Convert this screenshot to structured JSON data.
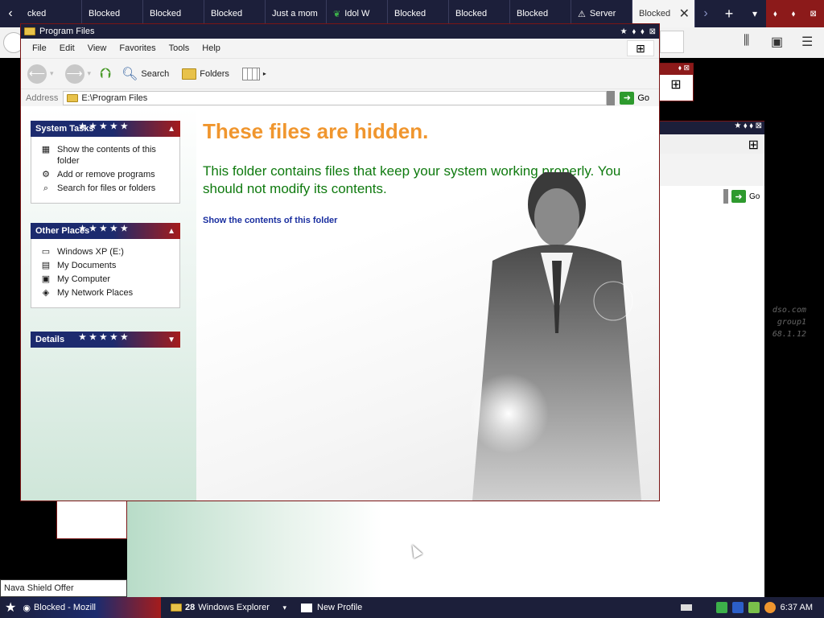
{
  "browser": {
    "tabs": [
      {
        "label": "cked"
      },
      {
        "label": "Blocked"
      },
      {
        "label": "Blocked"
      },
      {
        "label": "Blocked"
      },
      {
        "label": "Just a mom"
      },
      {
        "label": "Idol W"
      },
      {
        "label": "Blocked"
      },
      {
        "label": "Blocked"
      },
      {
        "label": "Blocked"
      },
      {
        "label": "Server"
      }
    ],
    "active_tab": "Blocked"
  },
  "background_window": {
    "go_label": "Go",
    "text_lines": [
      "dso.com",
      "group1",
      "68.1.12"
    ]
  },
  "explorer": {
    "title": "Program Files",
    "menu": [
      "File",
      "Edit",
      "View",
      "Favorites",
      "Tools",
      "Help"
    ],
    "toolbar": {
      "search": "Search",
      "folders": "Folders"
    },
    "address": {
      "label": "Address",
      "value": "E:\\Program Files",
      "go": "Go"
    },
    "system_tasks": {
      "title": "System Tasks",
      "items": [
        {
          "label": "Show the contents of this folder",
          "icon": "show-contents-icon"
        },
        {
          "label": "Add or remove programs",
          "icon": "add-remove-icon"
        },
        {
          "label": "Search for files or folders",
          "icon": "search-icon"
        }
      ]
    },
    "other_places": {
      "title": "Other Places",
      "items": [
        {
          "label": "Windows XP (E:)",
          "icon": "drive-icon"
        },
        {
          "label": "My Documents",
          "icon": "my-documents-icon"
        },
        {
          "label": "My Computer",
          "icon": "my-computer-icon"
        },
        {
          "label": "My Network Places",
          "icon": "network-places-icon"
        }
      ]
    },
    "details": {
      "title": "Details"
    },
    "content": {
      "heading": "These files are hidden.",
      "message": "This folder contains files that keep your system working properly. You should not modify its contents.",
      "link": "Show the contents of this folder"
    }
  },
  "notification": "Nava Shield Offer",
  "taskbar": {
    "start_task": "Blocked - Mozill",
    "group_count": "28",
    "group_label": "Windows Explorer",
    "task2": "New Profile",
    "clock": "6:37 AM"
  },
  "colors": {
    "heading": "#f0962e",
    "message": "#0f7a0f",
    "link": "#1a2fa0",
    "titlebar": "#1c1f3a",
    "accent_red": "#a51c1c"
  }
}
